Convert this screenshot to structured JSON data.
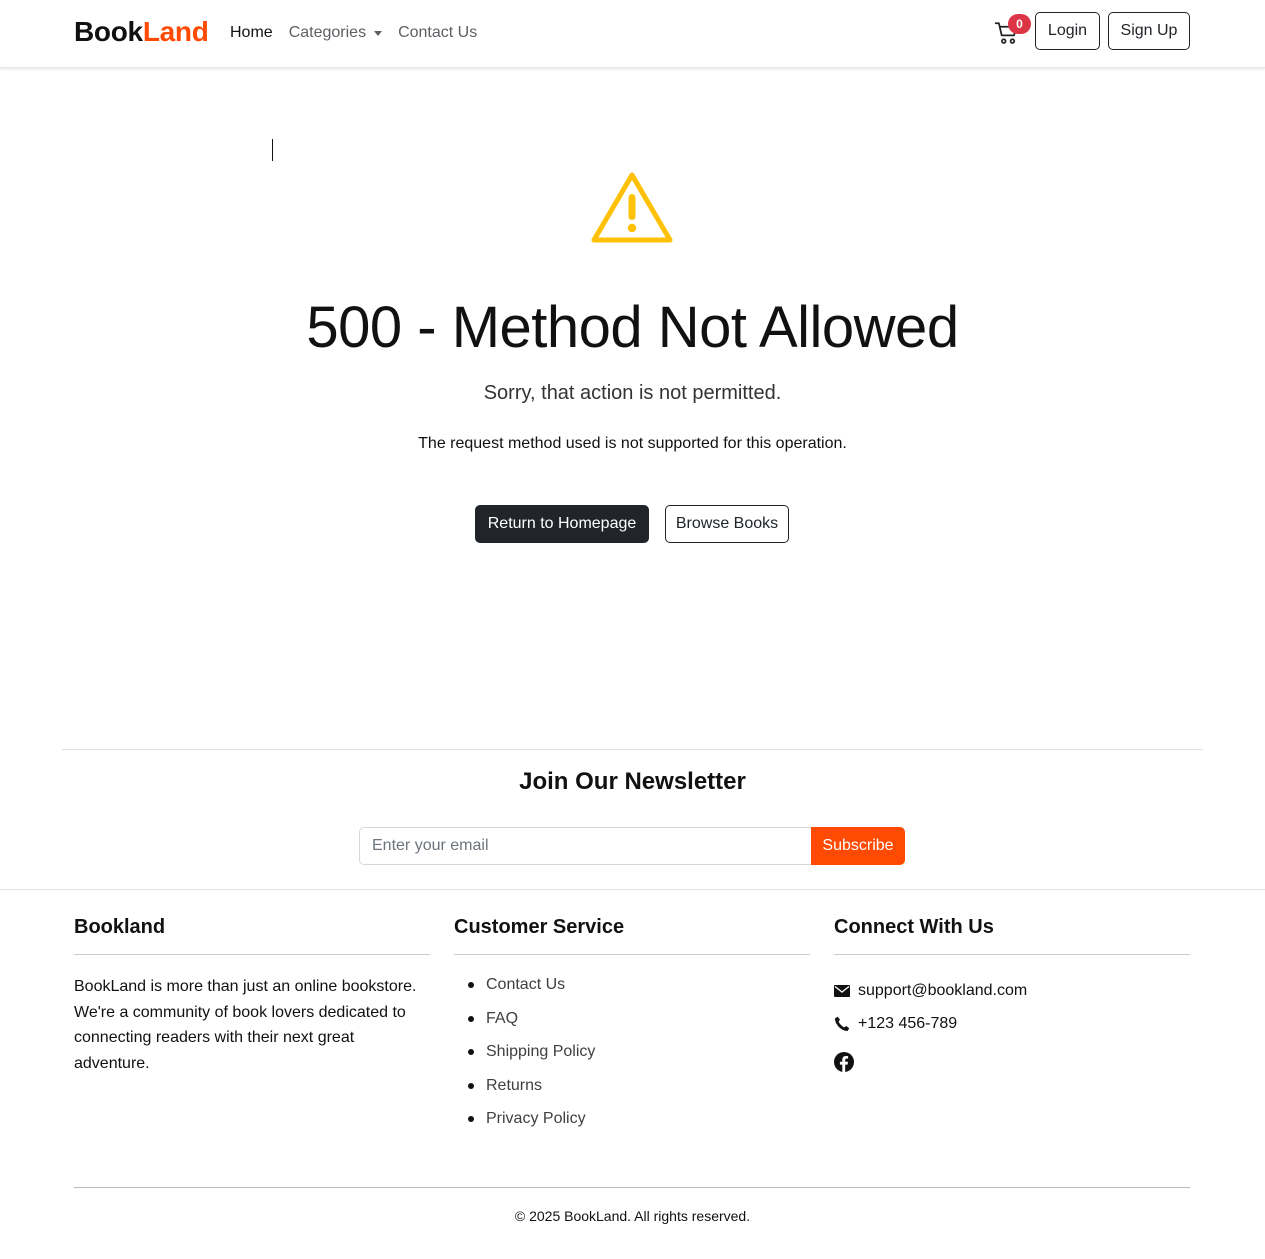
{
  "nav": {
    "brand_part1": "Book",
    "brand_part2": "Land",
    "brand_colors": {
      "primary": "#111111",
      "accent": "#ff4a03"
    },
    "links": [
      "Home",
      "Categories",
      "Contact Us"
    ],
    "cart_count": "0",
    "login_label": "Login",
    "signup_label": "Sign Up"
  },
  "error": {
    "icon": "warning-triangle-icon",
    "icon_color": "#ffc107",
    "title": "500 - Method Not Allowed",
    "lead": "Sorry, that action is not permitted.",
    "message": "The request method used is not supported for this operation.",
    "primary_button": "Return to Homepage",
    "secondary_button": "Browse Books"
  },
  "newsletter": {
    "title": "Join Our Newsletter",
    "placeholder": "Enter your email",
    "button": "Subscribe",
    "button_color": "#ff4a03"
  },
  "footer": {
    "about": {
      "heading": "Bookland",
      "text": "BookLand is more than just an online bookstore. We're a community of book lovers dedicated to connecting readers with their next great adventure."
    },
    "service": {
      "heading": "Customer Service",
      "links": [
        "Contact Us",
        "FAQ",
        "Shipping Policy",
        "Returns",
        "Privacy Policy"
      ]
    },
    "connect": {
      "heading": "Connect With Us",
      "email": "support@bookland.com",
      "phone": "+123 456-789",
      "social": [
        "facebook-icon"
      ]
    },
    "copyright": "© 2025 BookLand. All rights reserved."
  }
}
